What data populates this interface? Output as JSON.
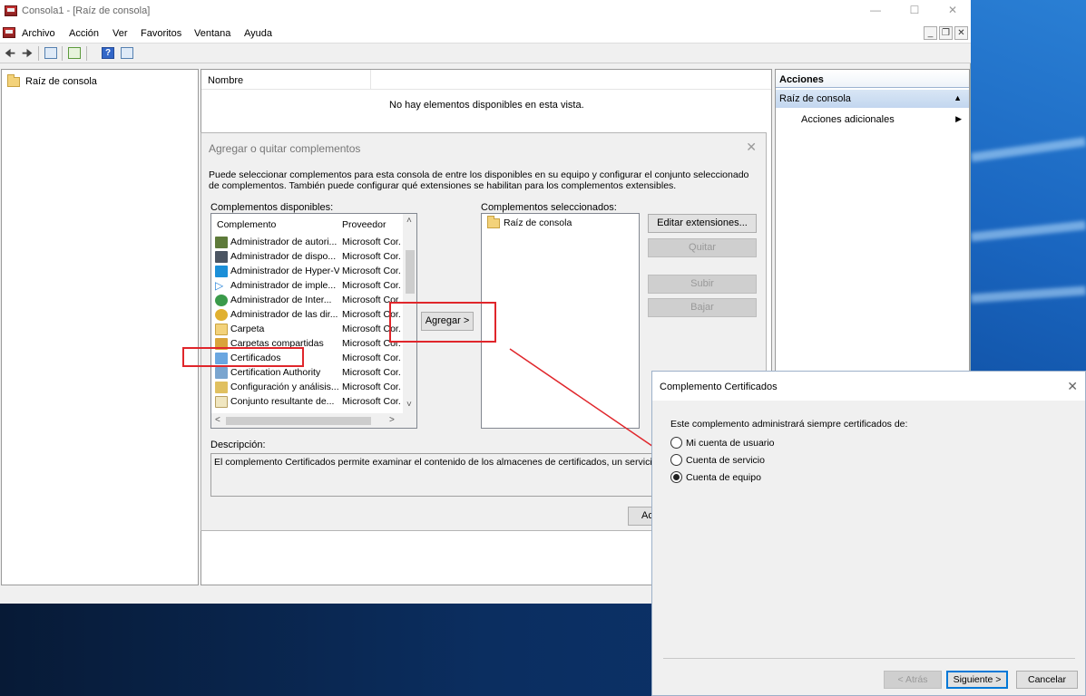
{
  "window": {
    "title": "Consola1 - [Raíz de consola]"
  },
  "menu": [
    "Archivo",
    "Acción",
    "Ver",
    "Favoritos",
    "Ventana",
    "Ayuda"
  ],
  "tree": {
    "root_label": "Raíz de consola"
  },
  "center": {
    "column_name": "Nombre",
    "empty_message": "No hay elementos disponibles en esta vista."
  },
  "actions": {
    "header": "Acciones",
    "section": "Raíz de consola",
    "more": "Acciones adicionales"
  },
  "add_remove_dialog": {
    "title": "Agregar o quitar complementos",
    "intro": "Puede seleccionar complementos para esta consola de entre los disponibles en su equipo y configurar el conjunto seleccionado de complementos. También puede configurar qué extensiones se habilitan para los complementos extensibles.",
    "available_label": "Complementos disponibles:",
    "selected_label": "Complementos seleccionados:",
    "col_snapin": "Complemento",
    "col_vendor": "Proveedor",
    "snapins": [
      {
        "name": "Administrador de autori...",
        "vendor": "Microsoft Cor."
      },
      {
        "name": "Administrador de dispo...",
        "vendor": "Microsoft Cor."
      },
      {
        "name": "Administrador de Hyper-V",
        "vendor": "Microsoft Cor."
      },
      {
        "name": "Administrador de imple...",
        "vendor": "Microsoft Cor."
      },
      {
        "name": "Administrador de Inter...",
        "vendor": "Microsoft Cor."
      },
      {
        "name": "Administrador de las dir...",
        "vendor": "Microsoft Cor."
      },
      {
        "name": "Carpeta",
        "vendor": "Microsoft Cor."
      },
      {
        "name": "Carpetas compartidas",
        "vendor": "Microsoft Cor."
      },
      {
        "name": "Certificados",
        "vendor": "Microsoft Cor."
      },
      {
        "name": "Certification Authority",
        "vendor": "Microsoft Cor."
      },
      {
        "name": "Configuración y análisis...",
        "vendor": "Microsoft Cor."
      },
      {
        "name": "Conjunto resultante de...",
        "vendor": "Microsoft Cor."
      }
    ],
    "selected_items": [
      "Raíz de consola"
    ],
    "add_button": "Agregar >",
    "edit_ext_button": "Editar extensiones...",
    "remove_button": "Quitar",
    "up_button": "Subir",
    "down_button": "Bajar",
    "description_label": "Descripción:",
    "description": "El complemento Certificados permite examinar el contenido de los almacenes de certificados, un servicio o un",
    "accept_button_partial": "Ac"
  },
  "cert_wizard": {
    "title": "Complemento Certificados",
    "prompt": "Este complemento administrará siempre certificados de:",
    "options": [
      {
        "label": "Mi cuenta de usuario",
        "selected": false
      },
      {
        "label": "Cuenta de servicio",
        "selected": false
      },
      {
        "label": "Cuenta de equipo",
        "selected": true
      }
    ],
    "back_button": "< Atrás",
    "next_button": "Siguiente >",
    "cancel_button": "Cancelar"
  },
  "colors": {
    "highlight_box": "#e0262b",
    "actions_section": "#c8daf0",
    "default_button": "#0078d7"
  }
}
